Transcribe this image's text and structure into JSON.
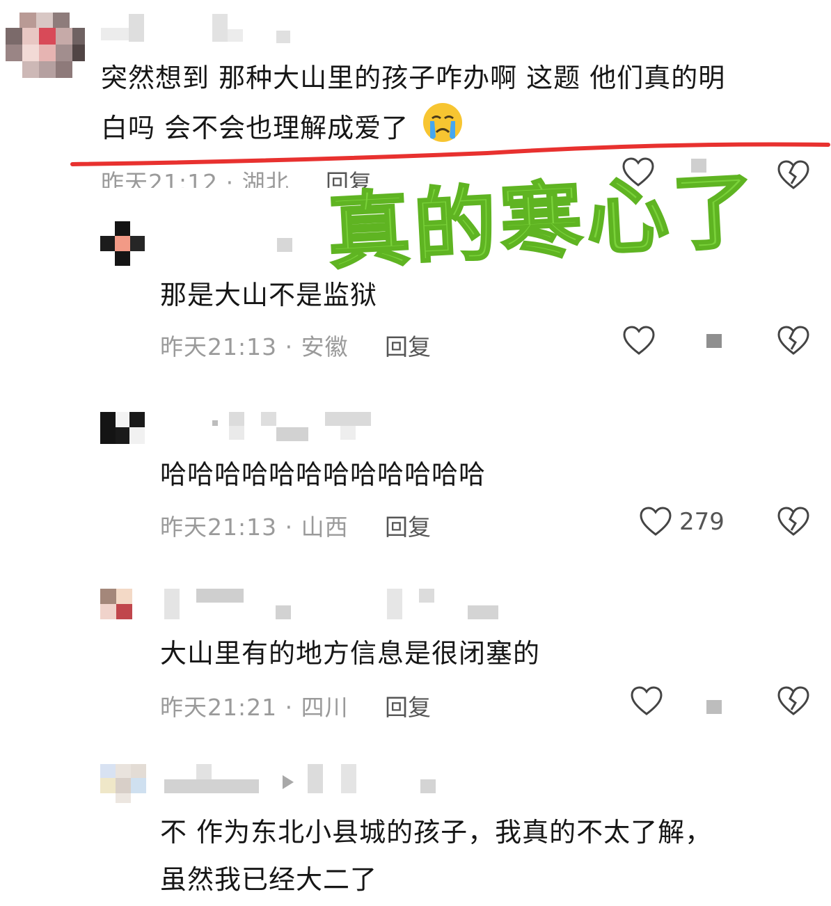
{
  "overlay": {
    "caption": "真的寒心了"
  },
  "comments": [
    {
      "text_lines": [
        "突然想到 那种大山里的孩子咋办啊 这题 他们真的明",
        "白吗 会不会也理解成爱了"
      ],
      "emoji": "crying-face",
      "time": "昨天21:12",
      "location": "湖北",
      "reply_label": "回复"
    },
    {
      "text_lines": [
        "那是大山不是监狱"
      ],
      "time": "昨天21:13",
      "location": "安徽",
      "reply_label": "回复"
    },
    {
      "text_lines": [
        "哈哈哈哈哈哈哈哈哈哈哈哈"
      ],
      "time": "昨天21:13",
      "location": "山西",
      "reply_label": "回复",
      "like_count": "279"
    },
    {
      "text_lines": [
        "大山里有的地方信息是很闭塞的"
      ],
      "time": "昨天21:21",
      "location": "四川",
      "reply_label": "回复"
    },
    {
      "text_lines": [
        "不 作为东北小县城的孩子，我真的不太了解，",
        "虽然我已经大二了"
      ]
    }
  ],
  "colors": {
    "annotation_line": "#e8312f",
    "overlay_text": "#7ad23a",
    "meta": "#9a9a9a"
  }
}
